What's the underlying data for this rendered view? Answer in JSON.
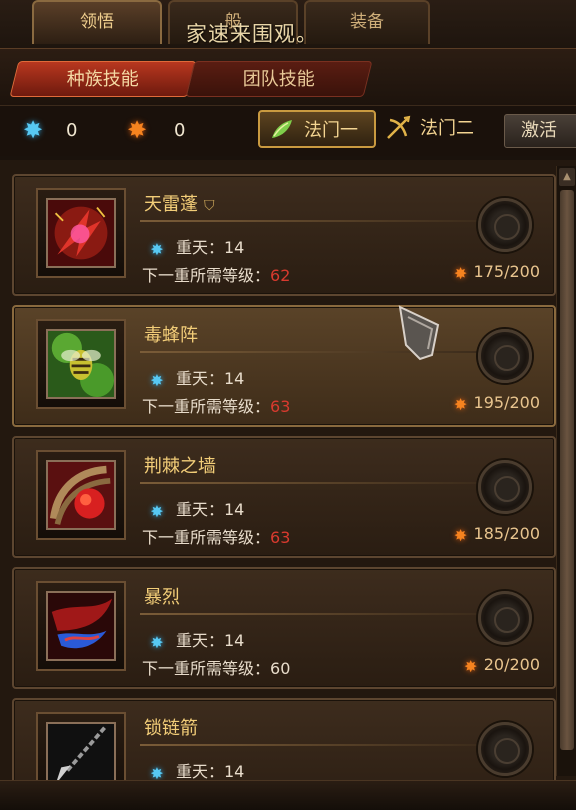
{
  "top_tabs": [
    {
      "label": "领悟",
      "active": true
    },
    {
      "label": "般",
      "active": false
    },
    {
      "label": "装备",
      "active": false
    }
  ],
  "banner": "家速来围观。",
  "sub_tabs": [
    {
      "label": "种族技能",
      "active": true
    },
    {
      "label": "团队技能",
      "active": false
    }
  ],
  "currency": {
    "blue": "0",
    "orange": "0"
  },
  "spell_tabs": [
    {
      "label": "法门一",
      "active": true
    },
    {
      "label": "法门二",
      "active": false
    }
  ],
  "activate_label": "激活",
  "skills": [
    {
      "name": "天雷蓬",
      "level_label": "重天：14",
      "req_label": "下一重所需等级：",
      "req_value": "62",
      "cost": "175/200",
      "req_color": "red"
    },
    {
      "name": "毒蜂阵",
      "level_label": "重天：14",
      "req_label": "下一重所需等级：",
      "req_value": "63",
      "cost": "195/200",
      "req_color": "red"
    },
    {
      "name": "荆棘之墙",
      "level_label": "重天：14",
      "req_label": "下一重所需等级：",
      "req_value": "63",
      "cost": "185/200",
      "req_color": "red"
    },
    {
      "name": "暴烈",
      "level_label": "重天：14",
      "req_label": "下一重所需等级：",
      "req_value": "60",
      "cost": "20/200",
      "req_color": "white"
    },
    {
      "name": "锁链箭",
      "level_label": "重天：14"
    }
  ],
  "colors": {
    "accent_gold": "#f2cd78",
    "red_value": "#d83a2e",
    "blue_gem": "#57c8f2",
    "orange_gem": "#f6831f"
  }
}
